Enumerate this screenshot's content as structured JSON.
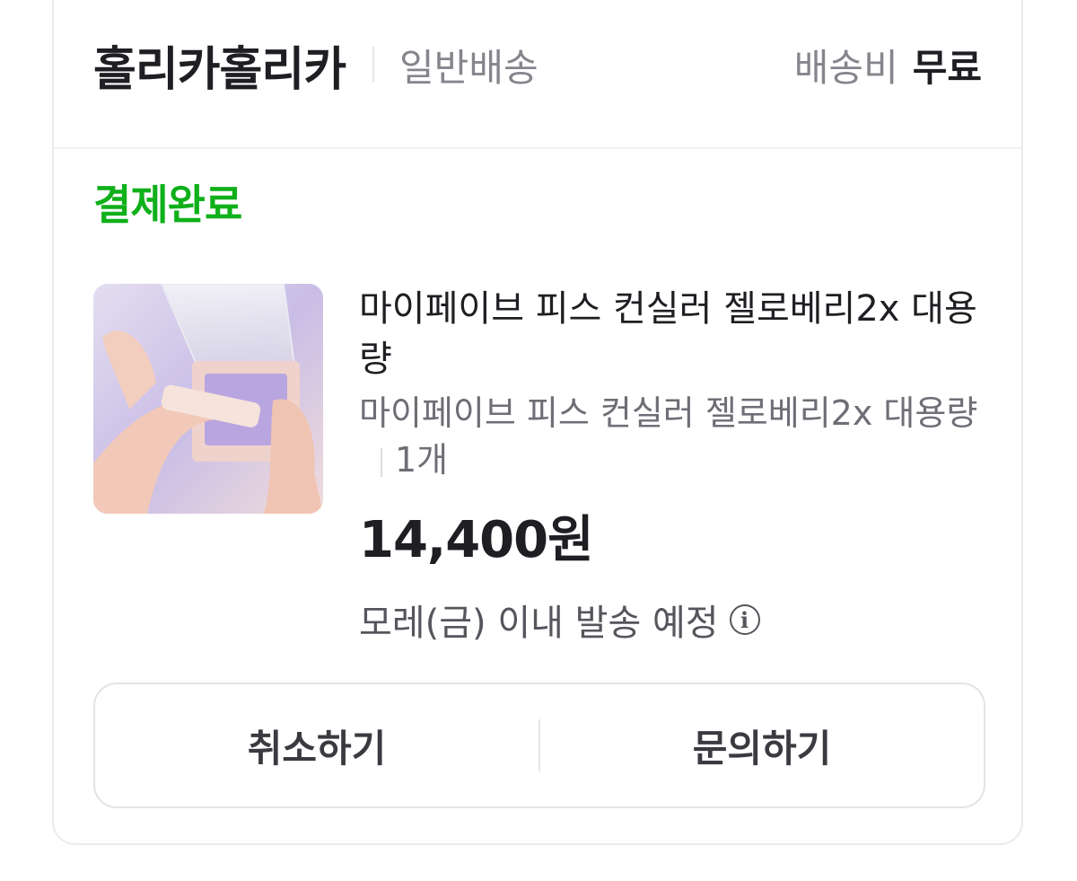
{
  "seller": {
    "name": "홀리카홀리카",
    "delivery_type": "일반배송",
    "shipping_label": "배송비",
    "shipping_value": "무료"
  },
  "order": {
    "status": "결제완료",
    "status_color": "#10b01a",
    "product_name": "마이페이브 피스 컨실러 젤로베리2x 대용량",
    "option": "마이페이브 피스 컨실러 젤로베리2x 대용량",
    "quantity": "1개",
    "price": "14,400원",
    "shipping_note": "모레(금) 이내 발송 예정",
    "info_icon_glyph": "i"
  },
  "actions": {
    "cancel_label": "취소하기",
    "inquiry_label": "문의하기"
  },
  "icons": {
    "info": "info-circle-icon"
  }
}
